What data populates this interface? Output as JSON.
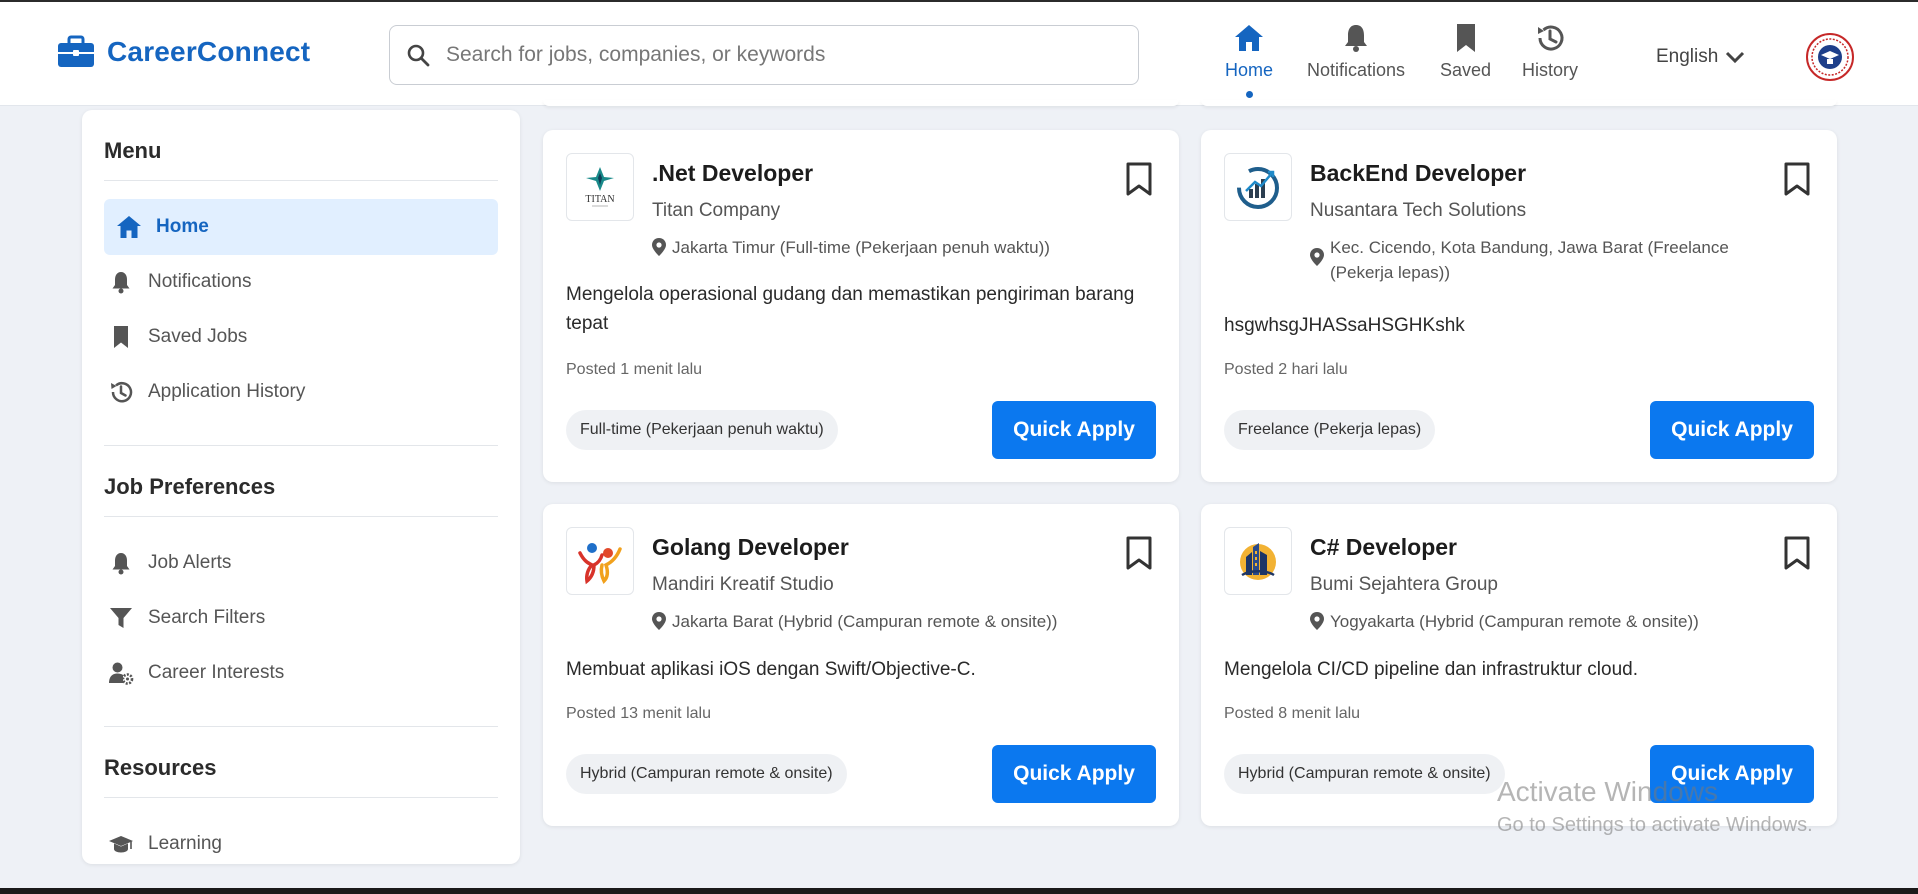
{
  "brand": {
    "name": "CareerConnect"
  },
  "search": {
    "placeholder": "Search for jobs, companies, or keywords"
  },
  "nav": [
    {
      "label": "Home",
      "icon": "home-icon",
      "active": true
    },
    {
      "label": "Notifications",
      "icon": "bell-icon"
    },
    {
      "label": "Saved",
      "icon": "bookmark-icon"
    },
    {
      "label": "History",
      "icon": "history-icon"
    }
  ],
  "language": {
    "label": "English"
  },
  "sidebar": {
    "menu_title": "Menu",
    "menu": [
      {
        "label": "Home",
        "icon": "home-icon",
        "active": true
      },
      {
        "label": "Notifications",
        "icon": "bell-icon"
      },
      {
        "label": "Saved Jobs",
        "icon": "bookmark-icon"
      },
      {
        "label": "Application History",
        "icon": "history-icon"
      }
    ],
    "prefs_title": "Job Preferences",
    "prefs": [
      {
        "label": "Job Alerts",
        "icon": "bell-icon"
      },
      {
        "label": "Search Filters",
        "icon": "filter-icon"
      },
      {
        "label": "Career Interests",
        "icon": "user-gear-icon"
      }
    ],
    "resources_title": "Resources",
    "resources": [
      {
        "label": "Learning",
        "icon": "graduation-cap-icon"
      }
    ]
  },
  "jobs": [
    {
      "title": ".Net Developer",
      "company": "Titan Company",
      "location": "Jakarta Timur (Full-time (Pekerjaan penuh waktu))",
      "description": "Mengelola operasional gudang dan memastikan pengiriman barang tepat",
      "posted": "Posted 1 menit lalu",
      "tag": "Full-time (Pekerjaan penuh waktu)",
      "apply_label": "Quick Apply",
      "logo_text": "TITAN"
    },
    {
      "title": "BackEnd Developer",
      "company": "Nusantara Tech Solutions",
      "location": "Kec. Cicendo, Kota Bandung, Jawa Barat (Freelance (Pekerja lepas))",
      "description": "hsgwhsgJHASsaHSGHKshk",
      "posted": "Posted 2 hari lalu",
      "tag": "Freelance (Pekerja lepas)",
      "apply_label": "Quick Apply"
    },
    {
      "title": "Golang Developer",
      "company": "Mandiri Kreatif Studio",
      "location": "Jakarta Barat (Hybrid (Campuran remote & onsite))",
      "description": "Membuat aplikasi iOS dengan Swift/Objective-C.",
      "posted": "Posted 13 menit lalu",
      "tag": "Hybrid (Campuran remote & onsite)",
      "apply_label": "Quick Apply"
    },
    {
      "title": "C# Developer",
      "company": "Bumi Sejahtera Group",
      "location": "Yogyakarta (Hybrid (Campuran remote & onsite))",
      "description": "Mengelola CI/CD pipeline dan infrastruktur cloud.",
      "posted": "Posted 8 menit lalu",
      "tag": "Hybrid (Campuran remote & onsite)",
      "apply_label": "Quick Apply"
    }
  ],
  "watermark": {
    "line1": "Activate Windows",
    "line2": "Go to Settings to activate Windows."
  },
  "colors": {
    "accent": "#1565c0",
    "button": "#0b78ef",
    "active_bg": "#e1efff"
  }
}
